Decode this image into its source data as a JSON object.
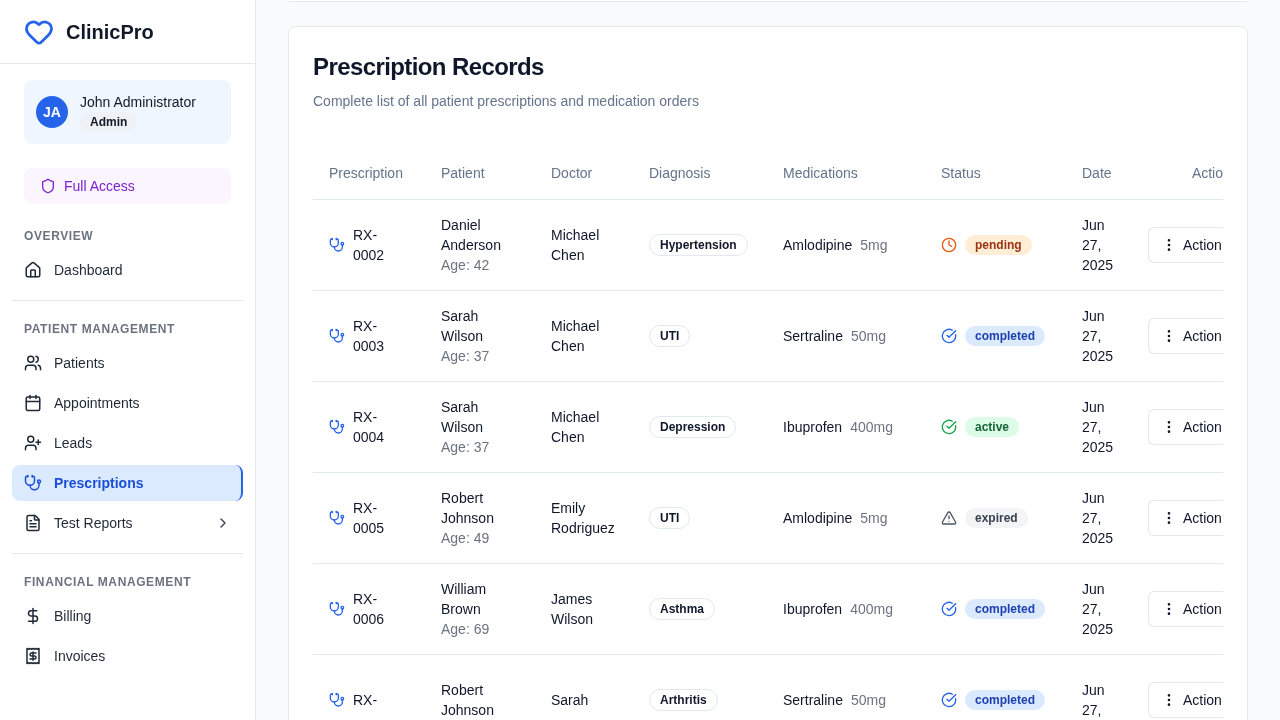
{
  "brand": {
    "name": "ClinicPro"
  },
  "user": {
    "initials": "JA",
    "name": "John Administrator",
    "role": "Admin"
  },
  "access": {
    "label": "Full Access"
  },
  "sidebar": {
    "sections": [
      {
        "title": "OVERVIEW",
        "items": [
          {
            "label": "Dashboard",
            "selected": false,
            "expandable": false
          }
        ]
      },
      {
        "title": "PATIENT MANAGEMENT",
        "items": [
          {
            "label": "Patients",
            "selected": false,
            "expandable": false
          },
          {
            "label": "Appointments",
            "selected": false,
            "expandable": false
          },
          {
            "label": "Leads",
            "selected": false,
            "expandable": false
          },
          {
            "label": "Prescriptions",
            "selected": true,
            "expandable": false
          },
          {
            "label": "Test Reports",
            "selected": false,
            "expandable": true
          }
        ]
      },
      {
        "title": "FINANCIAL MANAGEMENT",
        "items": [
          {
            "label": "Billing",
            "selected": false,
            "expandable": false
          },
          {
            "label": "Invoices",
            "selected": false,
            "expandable": false
          }
        ]
      }
    ]
  },
  "card": {
    "title": "Prescription Records",
    "subtitle": "Complete list of all patient prescriptions and medication orders"
  },
  "table": {
    "columns": [
      "Prescription",
      "Patient",
      "Doctor",
      "Diagnosis",
      "Medications",
      "Status",
      "Date",
      "Actio"
    ],
    "rows": [
      {
        "id": "RX-0002",
        "patient": "Daniel Anderson",
        "age": "Age: 42",
        "doctor": "Michael Chen",
        "diagnosis": "Hypertension",
        "medication": "Amlodipine",
        "dose": "5mg",
        "status": "pending",
        "date": "Jun 27, 2025",
        "action": "Action"
      },
      {
        "id": "RX-0003",
        "patient": "Sarah Wilson",
        "age": "Age: 37",
        "doctor": "Michael Chen",
        "diagnosis": "UTI",
        "medication": "Sertraline",
        "dose": "50mg",
        "status": "completed",
        "date": "Jun 27, 2025",
        "action": "Action"
      },
      {
        "id": "RX-0004",
        "patient": "Sarah Wilson",
        "age": "Age: 37",
        "doctor": "Michael Chen",
        "diagnosis": "Depression",
        "medication": "Ibuprofen",
        "dose": "400mg",
        "status": "active",
        "date": "Jun 27, 2025",
        "action": "Action"
      },
      {
        "id": "RX-0005",
        "patient": "Robert Johnson",
        "age": "Age: 49",
        "doctor": "Emily Rodriguez",
        "diagnosis": "UTI",
        "medication": "Amlodipine",
        "dose": "5mg",
        "status": "expired",
        "date": "Jun 27, 2025",
        "action": "Action"
      },
      {
        "id": "RX-0006",
        "patient": "William Brown",
        "age": "Age: 69",
        "doctor": "James Wilson",
        "diagnosis": "Asthma",
        "medication": "Ibuprofen",
        "dose": "400mg",
        "status": "completed",
        "date": "Jun 27, 2025",
        "action": "Action"
      },
      {
        "id": "RX-",
        "patient": "Robert Johnson",
        "doctor": "Sarah",
        "diagnosis": "Arthritis",
        "medication": "Sertraline",
        "dose": "50mg",
        "status": "completed",
        "date": "Jun 27,",
        "action": "Action"
      }
    ]
  }
}
